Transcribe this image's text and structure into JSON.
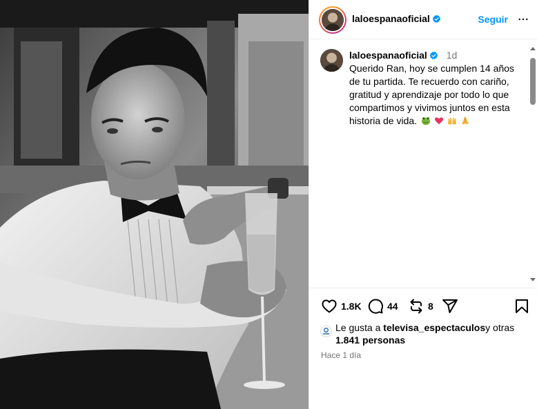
{
  "post": {
    "username": "laloespanaoficial",
    "follow_label": "Seguir",
    "caption": {
      "username": "laloespanaoficial",
      "time": "1d",
      "text": "Querido Ran, hoy se cumplen 14 años de tu partida. Te recuerdo con cariño, gratitud y aprendizaje por todo lo que compartimos y vivimos juntos en esta historia de vida.",
      "emojis": [
        "frog-emoji",
        "pink-heart-emoji",
        "raising-hands-emoji",
        "folded-hands-emoji"
      ]
    },
    "actions": {
      "likes_count": "1.8K",
      "comments_count": "44",
      "reposts_count": "8"
    },
    "liked_by": {
      "prefix": "Le gusta a",
      "user": "televisa_espectaculos",
      "middle": "y otras",
      "count": "1.841",
      "suffix": "personas"
    },
    "timestamp": "Hace 1 día"
  },
  "icons": {
    "verified": "verified-badge-icon",
    "like": "heart-icon",
    "comment": "comment-bubble-icon",
    "repost": "repost-icon",
    "share": "paper-plane-icon",
    "save": "bookmark-icon",
    "more": "more-options-icon"
  },
  "colors": {
    "accent": "#0095f6",
    "verified": "#0095f6",
    "secondary_text": "#737373",
    "border": "#efefef"
  }
}
